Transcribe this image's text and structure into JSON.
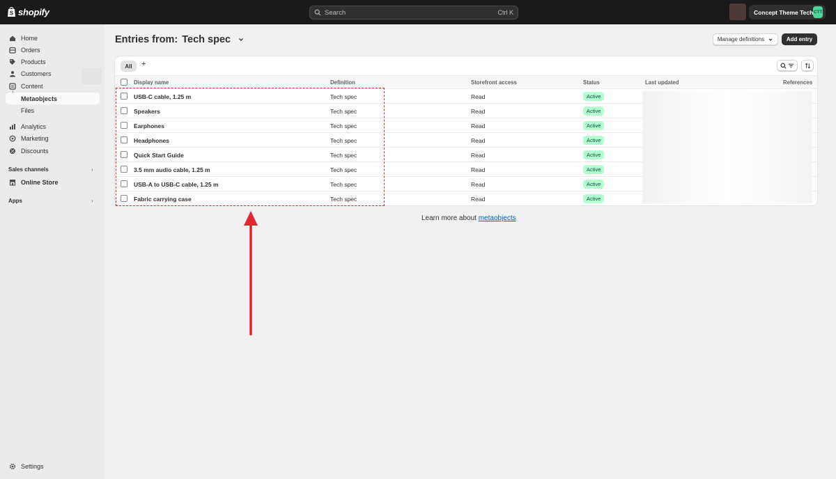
{
  "brand": {
    "name": "shopify"
  },
  "search": {
    "placeholder": "Search",
    "shortcut": "Ctrl K"
  },
  "store": {
    "name": "Concept Theme Tech",
    "initials": "CTT"
  },
  "sidebar": {
    "items": [
      {
        "label": "Home",
        "icon": "home-icon"
      },
      {
        "label": "Orders",
        "icon": "orders-icon"
      },
      {
        "label": "Products",
        "icon": "tag-icon"
      },
      {
        "label": "Customers",
        "icon": "person-icon"
      },
      {
        "label": "Content",
        "icon": "content-icon"
      },
      {
        "label": "Metaobjects",
        "icon": ""
      },
      {
        "label": "Files",
        "icon": ""
      },
      {
        "label": "Analytics",
        "icon": "analytics-icon"
      },
      {
        "label": "Marketing",
        "icon": "target-icon"
      },
      {
        "label": "Discounts",
        "icon": "discount-icon"
      }
    ],
    "sales_channels_label": "Sales channels",
    "online_store_label": "Online Store",
    "apps_label": "Apps",
    "settings_label": "Settings"
  },
  "page": {
    "title_prefix": "Entries from:",
    "title_value": "Tech spec",
    "manage_label": "Manage definitions",
    "add_label": "Add entry"
  },
  "table": {
    "tab_all": "All",
    "tab_add": "+",
    "columns": [
      "Display name",
      "Definition",
      "Storefront access",
      "Status",
      "Last updated",
      "References"
    ],
    "rows": [
      {
        "name": "USB-C cable, 1.25 m",
        "definition": "Tech spec",
        "access": "Read",
        "status": "Active"
      },
      {
        "name": "Speakers",
        "definition": "Tech spec",
        "access": "Read",
        "status": "Active"
      },
      {
        "name": "Earphones",
        "definition": "Tech spec",
        "access": "Read",
        "status": "Active"
      },
      {
        "name": "Headphones",
        "definition": "Tech spec",
        "access": "Read",
        "status": "Active"
      },
      {
        "name": "Quick Start Guide",
        "definition": "Tech spec",
        "access": "Read",
        "status": "Active"
      },
      {
        "name": "3.5 mm audio cable, 1.25 m",
        "definition": "Tech spec",
        "access": "Read",
        "status": "Active"
      },
      {
        "name": "USB-A to USB-C cable, 1.25 m",
        "definition": "Tech spec",
        "access": "Read",
        "status": "Active"
      },
      {
        "name": "Fabric carrying case",
        "definition": "Tech spec",
        "access": "Read",
        "status": "Active"
      }
    ]
  },
  "footer": {
    "learn_text": "Learn more about ",
    "learn_link": "metaobjects"
  },
  "colors": {
    "topbar": "#1a1a1a",
    "active_badge": "#b4fed2",
    "annotation": "#e3262b",
    "link": "#005bd3"
  }
}
